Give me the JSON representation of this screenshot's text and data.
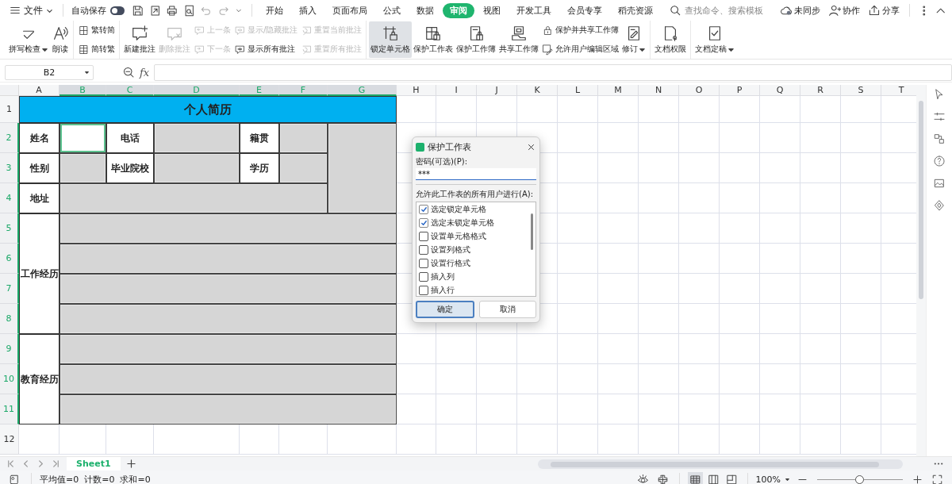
{
  "menu": {
    "file": "文件",
    "autosave": {
      "label": "自动保存",
      "on": false
    },
    "tabs": [
      {
        "label": "开始",
        "selected": false
      },
      {
        "label": "插入",
        "selected": false
      },
      {
        "label": "页面布局",
        "selected": false
      },
      {
        "label": "公式",
        "selected": false
      },
      {
        "label": "数据",
        "selected": false
      },
      {
        "label": "审阅",
        "selected": true
      },
      {
        "label": "视图",
        "selected": false
      },
      {
        "label": "开发工具",
        "selected": false
      },
      {
        "label": "会员专享",
        "selected": false
      },
      {
        "label": "稻壳资源",
        "selected": false
      }
    ],
    "search": {
      "placeholder": "查找命令、搜索模板"
    },
    "actions": [
      "未同步",
      "协作",
      "分享"
    ]
  },
  "ribbon": [
    {
      "items": [
        {
          "kind": "large",
          "label": "拼写检查",
          "dropdown": true,
          "disabled": false,
          "selected": false
        },
        {
          "kind": "large",
          "label": "朗读",
          "dropdown": false,
          "disabled": false,
          "selected": false
        }
      ]
    },
    {
      "items": [
        {
          "kind": "small",
          "label": "繁转简",
          "disabled": false
        },
        {
          "kind": "small",
          "label": "简转繁",
          "disabled": false
        }
      ]
    },
    {
      "items": [
        {
          "kind": "large",
          "label": "新建批注",
          "dropdown": false,
          "disabled": false,
          "selected": false
        },
        {
          "kind": "large",
          "label": "删除批注",
          "dropdown": false,
          "disabled": true,
          "selected": false
        },
        {
          "kind": "small",
          "label": "上一条",
          "disabled": true
        },
        {
          "kind": "small",
          "label": "下一条",
          "disabled": true
        },
        {
          "kind": "small",
          "label": "显示/隐藏批注",
          "disabled": true
        },
        {
          "kind": "small",
          "label": "显示所有批注",
          "disabled": false
        },
        {
          "kind": "small",
          "label": "重置当前批注",
          "disabled": true
        },
        {
          "kind": "small",
          "label": "重置所有批注",
          "disabled": true
        }
      ]
    },
    {
      "items": [
        {
          "kind": "large",
          "label": "锁定单元格",
          "dropdown": false,
          "disabled": false,
          "selected": true
        },
        {
          "kind": "large",
          "label": "保护工作表",
          "dropdown": false,
          "disabled": false,
          "selected": false
        },
        {
          "kind": "large",
          "label": "保护工作簿",
          "dropdown": false,
          "disabled": false,
          "selected": false
        },
        {
          "kind": "large",
          "label": "共享工作簿",
          "dropdown": false,
          "disabled": false,
          "selected": false
        },
        {
          "kind": "small",
          "label": "保护并共享工作簿",
          "disabled": false
        },
        {
          "kind": "small",
          "label": "允许用户编辑区域",
          "disabled": false
        },
        {
          "kind": "large",
          "label": "修订",
          "dropdown": true,
          "disabled": false,
          "selected": false
        }
      ]
    },
    {
      "items": [
        {
          "kind": "large",
          "label": "文档权限",
          "dropdown": false,
          "disabled": false,
          "selected": false
        }
      ]
    },
    {
      "items": [
        {
          "kind": "large",
          "label": "文档定稿",
          "dropdown": true,
          "disabled": false,
          "selected": false
        }
      ]
    }
  ],
  "formula_bar": {
    "name_box": "B2",
    "fx": "fx"
  },
  "sheet": {
    "columns": [
      {
        "label": "A",
        "selected": false
      },
      {
        "label": "B",
        "selected": true
      },
      {
        "label": "C",
        "selected": true
      },
      {
        "label": "D",
        "selected": true
      },
      {
        "label": "E",
        "selected": true
      },
      {
        "label": "F",
        "selected": true
      },
      {
        "label": "G",
        "selected": true
      },
      {
        "label": "H",
        "selected": false
      },
      {
        "label": "I",
        "selected": false
      },
      {
        "label": "J",
        "selected": false
      },
      {
        "label": "K",
        "selected": false
      },
      {
        "label": "L",
        "selected": false
      },
      {
        "label": "M",
        "selected": false
      },
      {
        "label": "N",
        "selected": false
      },
      {
        "label": "O",
        "selected": false
      },
      {
        "label": "P",
        "selected": false
      },
      {
        "label": "Q",
        "selected": false
      },
      {
        "label": "R",
        "selected": false
      },
      {
        "label": "S",
        "selected": false
      },
      {
        "label": "T",
        "selected": false
      }
    ],
    "rows": [
      {
        "label": "1",
        "selected": false
      },
      {
        "label": "2",
        "selected": true
      },
      {
        "label": "3",
        "selected": true
      },
      {
        "label": "4",
        "selected": true
      },
      {
        "label": "5",
        "selected": true
      },
      {
        "label": "6",
        "selected": true
      },
      {
        "label": "7",
        "selected": true
      },
      {
        "label": "8",
        "selected": true
      },
      {
        "label": "9",
        "selected": true
      },
      {
        "label": "10",
        "selected": true
      },
      {
        "label": "11",
        "selected": true
      },
      {
        "label": "12",
        "selected": false
      }
    ],
    "resume": {
      "title": "个人简历",
      "cells": [
        {
          "kind": "label",
          "text": "姓名"
        },
        {
          "kind": "fill",
          "selected": true
        },
        {
          "kind": "label",
          "text": "电话"
        },
        {
          "kind": "fill",
          "selected": false
        },
        {
          "kind": "label",
          "text": "籍贯"
        },
        {
          "kind": "fill",
          "selected": false
        },
        {
          "kind": "fill",
          "selected": false
        },
        {
          "kind": "label",
          "text": "性别"
        },
        {
          "kind": "fill",
          "selected": false
        },
        {
          "kind": "label",
          "text": "毕业院校"
        },
        {
          "kind": "fill",
          "selected": false
        },
        {
          "kind": "label",
          "text": "学历"
        },
        {
          "kind": "fill",
          "selected": false
        },
        {
          "kind": "label",
          "text": "地址"
        },
        {
          "kind": "fill",
          "selected": false
        },
        {
          "kind": "label",
          "text": "工作经历"
        },
        {
          "kind": "fill",
          "selected": false
        },
        {
          "kind": "fill",
          "selected": false
        },
        {
          "kind": "fill",
          "selected": false
        },
        {
          "kind": "fill",
          "selected": false
        },
        {
          "kind": "label",
          "text": "教育经历"
        },
        {
          "kind": "fill",
          "selected": false
        },
        {
          "kind": "fill",
          "selected": false
        },
        {
          "kind": "fill",
          "selected": false
        }
      ]
    }
  },
  "dialog": {
    "title": "保护工作表",
    "password_label": "密码(可选)(P):",
    "password": "***",
    "permissions_label": "允许此工作表的所有用户进行(A):",
    "permissions": [
      {
        "label": "选定锁定单元格",
        "checked": true
      },
      {
        "label": "选定未锁定单元格",
        "checked": true
      },
      {
        "label": "设置单元格格式",
        "checked": false
      },
      {
        "label": "设置列格式",
        "checked": false
      },
      {
        "label": "设置行格式",
        "checked": false
      },
      {
        "label": "插入列",
        "checked": false
      },
      {
        "label": "插入行",
        "checked": false
      }
    ],
    "buttons": [
      {
        "label": "确定",
        "primary": true
      },
      {
        "label": "取消",
        "primary": false
      }
    ]
  },
  "sheet_tabs": [
    {
      "label": "Sheet1",
      "selected": true
    }
  ],
  "status": {
    "stats": [
      "平均值=0",
      "计数=0",
      "求和=0"
    ],
    "view_modes": [
      {
        "selected": true
      },
      {
        "selected": false
      },
      {
        "selected": false
      }
    ],
    "zoom": "100%",
    "zoom_slider": {
      "level": 0.49
    }
  }
}
